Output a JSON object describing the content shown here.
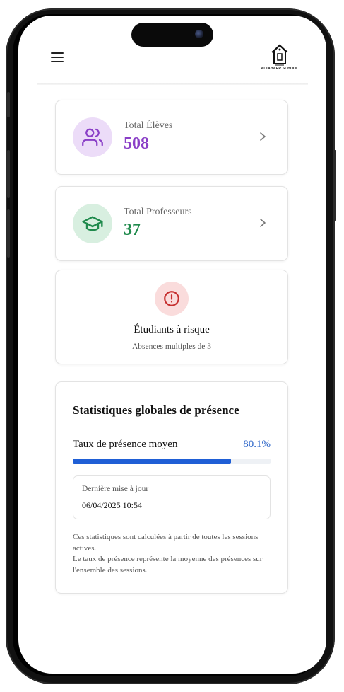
{
  "app": {
    "logo_text": "ALTABARR SCHOOL",
    "menu_icon": "hamburger-menu-icon"
  },
  "cards": {
    "students": {
      "label": "Total Élèves",
      "value": "508",
      "icon": "users-icon",
      "accent": "#8a3fc7",
      "icon_bg": "#ecdcf8"
    },
    "teachers": {
      "label": "Total Professeurs",
      "value": "37",
      "icon": "graduation-cap-icon",
      "accent": "#1f8a4c",
      "icon_bg": "#d8efe0"
    },
    "at_risk": {
      "title": "Étudiants à risque",
      "subtitle": "Absences multiples de 3",
      "icon": "alert-circle-icon",
      "accent": "#c62f2f",
      "icon_bg": "#fadcdc"
    }
  },
  "stats": {
    "title": "Statistiques globales de présence",
    "rate_label": "Taux de présence moyen",
    "rate_value": "80.1%",
    "rate_fraction": 0.801,
    "rate_color": "#1f5fd6",
    "last_update_label": "Dernière mise à jour",
    "last_update_value": "06/04/2025 10:54",
    "note_line1": "Ces statistiques sont calculées à partir de toutes les sessions actives.",
    "note_line2": "Le taux de présence représente la moyenne des présences sur l'ensemble des sessions."
  }
}
